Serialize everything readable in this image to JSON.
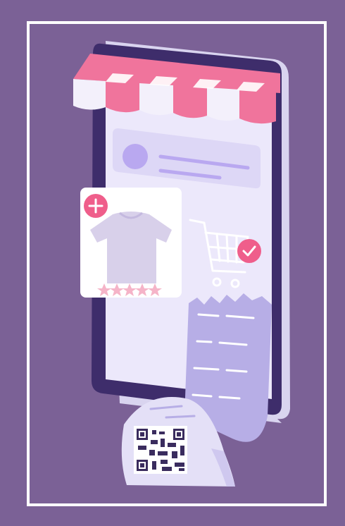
{
  "illustration": {
    "subject": "online-shopping-phone",
    "colors": {
      "background": "#7b6196",
      "border": "#ffffff",
      "phone_body": "#3e2d6b",
      "phone_side": "#d9d4ef",
      "screen": "#ece8fb",
      "awning_pink": "#f0749c",
      "awning_white": "#f3f0fb",
      "accent_purple": "#b9a8f0",
      "receipt": "#b7aee6",
      "receipt_light": "#e4e0f7",
      "qr": "#3a2c5e",
      "badge_pink": "#ef5e8b",
      "star": "#f5b4c8",
      "tshirt": "#d8d0ea"
    },
    "product_card": {
      "rating_stars": 5,
      "add_icon": "plus-icon",
      "item_icon": "tshirt-icon"
    },
    "cart": {
      "icon": "shopping-cart-icon",
      "badge_icon": "check-icon"
    },
    "receipt": {
      "code_icon": "qr-code-icon"
    }
  }
}
